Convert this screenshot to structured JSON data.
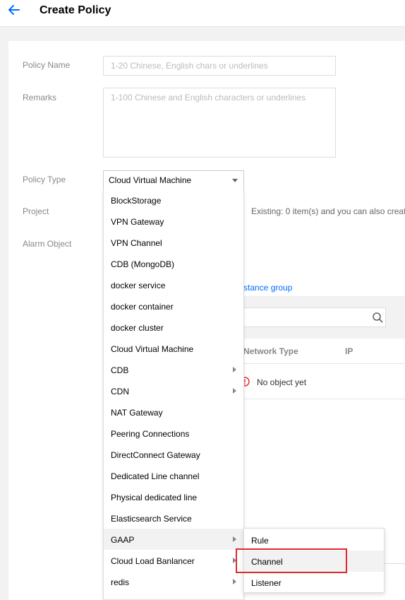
{
  "header": {
    "title": "Create Policy"
  },
  "form": {
    "policy_name_label": "Policy Name",
    "policy_name_placeholder": "1-20 Chinese, English chars or underlines",
    "remarks_label": "Remarks",
    "remarks_placeholder": "1-100 Chinese and English characters or underlines",
    "policy_type_label": "Policy Type",
    "policy_type_value": "Cloud Virtual Machine",
    "project_label": "Project",
    "project_hint": "Existing: 0 item(s) and you can also create",
    "alarm_object_label": "Alarm Object",
    "instance_group_link": "stance group"
  },
  "object_table": {
    "columns": [
      "Network Type",
      "IP"
    ],
    "empty_text": "No object yet"
  },
  "dropdown": {
    "items": [
      {
        "label": "BlockStorage",
        "has_submenu": false
      },
      {
        "label": "VPN Gateway",
        "has_submenu": false
      },
      {
        "label": "VPN Channel",
        "has_submenu": false
      },
      {
        "label": "CDB (MongoDB)",
        "has_submenu": false
      },
      {
        "label": "docker service",
        "has_submenu": false
      },
      {
        "label": "docker container",
        "has_submenu": false
      },
      {
        "label": "docker cluster",
        "has_submenu": false
      },
      {
        "label": "Cloud Virtual Machine",
        "has_submenu": false
      },
      {
        "label": "CDB",
        "has_submenu": true
      },
      {
        "label": "CDN",
        "has_submenu": true
      },
      {
        "label": "NAT Gateway",
        "has_submenu": false
      },
      {
        "label": "Peering Connections",
        "has_submenu": false
      },
      {
        "label": "DirectConnect Gateway",
        "has_submenu": false
      },
      {
        "label": "Dedicated Line channel",
        "has_submenu": false
      },
      {
        "label": "Physical dedicated line",
        "has_submenu": false
      },
      {
        "label": "Elasticsearch Service",
        "has_submenu": false
      },
      {
        "label": "GAAP",
        "has_submenu": true,
        "hovered": true
      },
      {
        "label": "Cloud Load Banlancer",
        "has_submenu": true
      },
      {
        "label": "redis",
        "has_submenu": true
      }
    ],
    "submenu": [
      {
        "label": "Rule"
      },
      {
        "label": "Channel",
        "hovered": true
      },
      {
        "label": "Listener"
      }
    ]
  },
  "colors": {
    "accent": "#006eff",
    "highlight": "#e0282e",
    "hover": "#f2f2f2"
  },
  "icons": [
    "back-arrow-icon",
    "search-icon",
    "caret-down-icon",
    "chevron-right-icon",
    "info-circle-icon"
  ]
}
